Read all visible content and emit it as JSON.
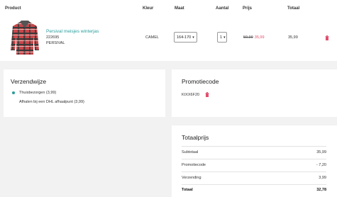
{
  "cart": {
    "headers": {
      "product": "Product",
      "color": "Kleur",
      "size": "Maat",
      "qty": "Aantal",
      "price": "Prijs",
      "total": "Totaal"
    },
    "item": {
      "name": "Persival meisjes winterjas",
      "code": "222695",
      "brand": "PERSIVAL",
      "color": "CAMEL",
      "size": "164-170",
      "qty": "1",
      "old_price": "59,99",
      "new_price": "35,99",
      "total": "35,99",
      "image_icon": "plaid-winter-jacket"
    }
  },
  "shipping": {
    "title": "Verzendwijze",
    "options": [
      {
        "label": "Thuisbezorgen (3,99)",
        "selected": true
      },
      {
        "label": "Afhalen bij een DHL afhaalpunt (3,99)",
        "selected": false
      }
    ]
  },
  "promo": {
    "title": "Promotiecode",
    "code": "KIXX6F20"
  },
  "totals": {
    "title": "Totaalprijs",
    "rows": [
      {
        "label": "Subtotaal",
        "value": "35,99"
      },
      {
        "label": "Promotiecode",
        "value": "- 7,20"
      },
      {
        "label": "Verzending",
        "value": "3,99"
      },
      {
        "label": "Totaal",
        "value": "32,78"
      }
    ]
  },
  "colors": {
    "accent": "#2a9d9d",
    "sale": "#e0506e",
    "trash": "#e0506e"
  }
}
